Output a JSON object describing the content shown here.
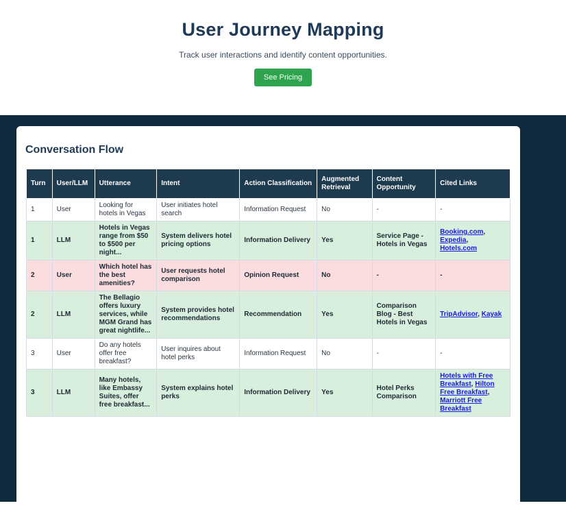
{
  "header": {
    "title": "User Journey Mapping",
    "subtitle": "Track user interactions and identify content opportunities.",
    "cta_label": "See Pricing"
  },
  "section": {
    "title": "Conversation Flow"
  },
  "table": {
    "headers": [
      "Turn",
      "User/LLM",
      "Utterance",
      "Intent",
      "Action Classification",
      "Augmented Retrieval",
      "Content Opportunity",
      "Cited Links"
    ],
    "rows": [
      {
        "turn": "1",
        "who": "User",
        "utterance": "Looking for hotels in Vegas",
        "intent": "User initiates hotel search",
        "action": "Information Request",
        "augmented": "No",
        "opportunity": "-",
        "links": [],
        "links_text": "-"
      },
      {
        "turn": "1",
        "who": "LLM",
        "utterance": "Hotels in Vegas range from $50 to $500 per night...",
        "intent": "System delivers hotel pricing options",
        "action": "Information Delivery",
        "augmented": "Yes",
        "opportunity": "Service Page - Hotels in Vegas",
        "links": [
          "Booking.com",
          "Expedia",
          "Hotels.com"
        ]
      },
      {
        "turn": "2",
        "who": "User",
        "utterance": "Which hotel has the best amenities?",
        "intent": "User requests hotel comparison",
        "action": "Opinion Request",
        "augmented": "No",
        "opportunity": "-",
        "links": [],
        "links_text": "-"
      },
      {
        "turn": "2",
        "who": "LLM",
        "utterance": "The Bellagio offers luxury services, while MGM Grand has great nightlife...",
        "intent": "System provides hotel recommendations",
        "action": "Recommendation",
        "augmented": "Yes",
        "opportunity": "Comparison Blog - Best Hotels in Vegas",
        "links": [
          "TripAdvisor",
          "Kayak"
        ]
      },
      {
        "turn": "3",
        "who": "User",
        "utterance": "Do any hotels offer free breakfast?",
        "intent": "User inquires about hotel perks",
        "action": "Information Request",
        "augmented": "No",
        "opportunity": "-",
        "links": [],
        "links_text": "-"
      },
      {
        "turn": "3",
        "who": "LLM",
        "utterance": "Many hotels, like Embassy Suites, offer free breakfast...",
        "intent": "System explains hotel perks",
        "action": "Information Delivery",
        "augmented": "Yes",
        "opportunity": "Hotel Perks Comparison",
        "links": [
          "Hotels with Free Breakfast",
          "Hilton Free Breakfast",
          "Marriott Free Breakfast"
        ]
      }
    ]
  },
  "colors": {
    "dark_bg": "#0f2a3d",
    "header_bg": "#1e3a4f",
    "llm_row": "#d7efdc",
    "opinion_row": "#fbdde0",
    "cta": "#2ea44f"
  }
}
